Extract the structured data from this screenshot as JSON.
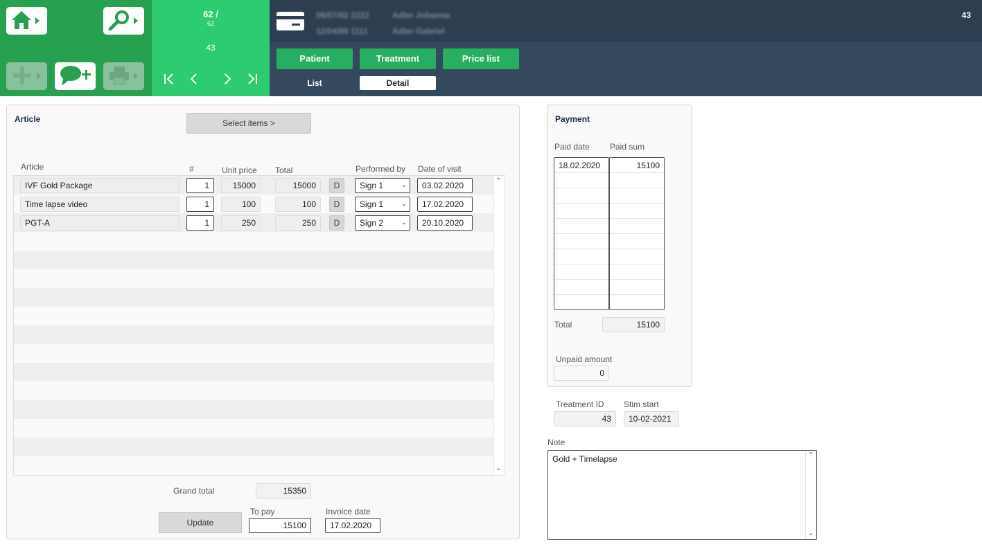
{
  "toolbar": {
    "home_icon": "home-icon",
    "search_icon": "search-icon",
    "add_icon": "plus-icon",
    "comment_add_icon": "comment-add-icon",
    "print_icon": "printer-icon"
  },
  "navigator": {
    "record_position": "62 /",
    "record_total": "62",
    "record_id": "43",
    "first_icon": "first-record-icon",
    "prev_icon": "previous-record-icon",
    "next_icon": "next-record-icon",
    "last_icon": "last-record-icon"
  },
  "header": {
    "card_icon": "id-card-icon",
    "patient1_dob": "06/07/82 2222",
    "patient1_name": "Adler Johanna",
    "patient2_dob": "12/04/89 1111",
    "patient2_name": "Adler Gabriel",
    "record_id": "43"
  },
  "tabs": {
    "patient": "Patient",
    "treatment": "Treatment",
    "price_list": "Price list",
    "list": "List",
    "detail": "Detail"
  },
  "article_panel": {
    "title": "Article",
    "select_items_label": "Select items >",
    "col_article": "Article",
    "col_qty": "#",
    "col_unit_price": "Unit price",
    "col_total": "Total",
    "col_performed_by": "Performed by",
    "col_date_of_visit": "Date of visit",
    "rows": [
      {
        "article": "IVF Gold Package",
        "qty": "1",
        "unit_price": "15000",
        "total": "15000",
        "d": "D",
        "performed_by": "Sign 1",
        "date": "03.02.2020"
      },
      {
        "article": "Time lapse video",
        "qty": "1",
        "unit_price": "100",
        "total": "100",
        "d": "D",
        "performed_by": "Sign 1",
        "date": "17.02.2020"
      },
      {
        "article": "PGT-A",
        "qty": "1",
        "unit_price": "250",
        "total": "250",
        "d": "D",
        "performed_by": "Sign 2",
        "date": "20.10.2020"
      }
    ],
    "grand_total_label": "Grand total",
    "grand_total": "15350",
    "update_label": "Update",
    "to_pay_label": "To pay",
    "to_pay": "15100",
    "invoice_date_label": "Invoice date",
    "invoice_date": "17.02.2020"
  },
  "payment_panel": {
    "title": "Payment",
    "col_paid_date": "Paid date",
    "col_paid_sum": "Paid sum",
    "rows": [
      {
        "paid_date": "18.02.2020",
        "paid_sum": "15100"
      }
    ],
    "total_label": "Total",
    "total": "15100",
    "unpaid_label": "Unpaid amount",
    "unpaid": "0"
  },
  "treatment_info": {
    "treatment_id_label": "Treatment ID",
    "treatment_id": "43",
    "stim_start_label": "Stim start",
    "stim_start": "10-02-2021"
  },
  "note": {
    "label": "Note",
    "text": "Gold + Timelapse"
  }
}
